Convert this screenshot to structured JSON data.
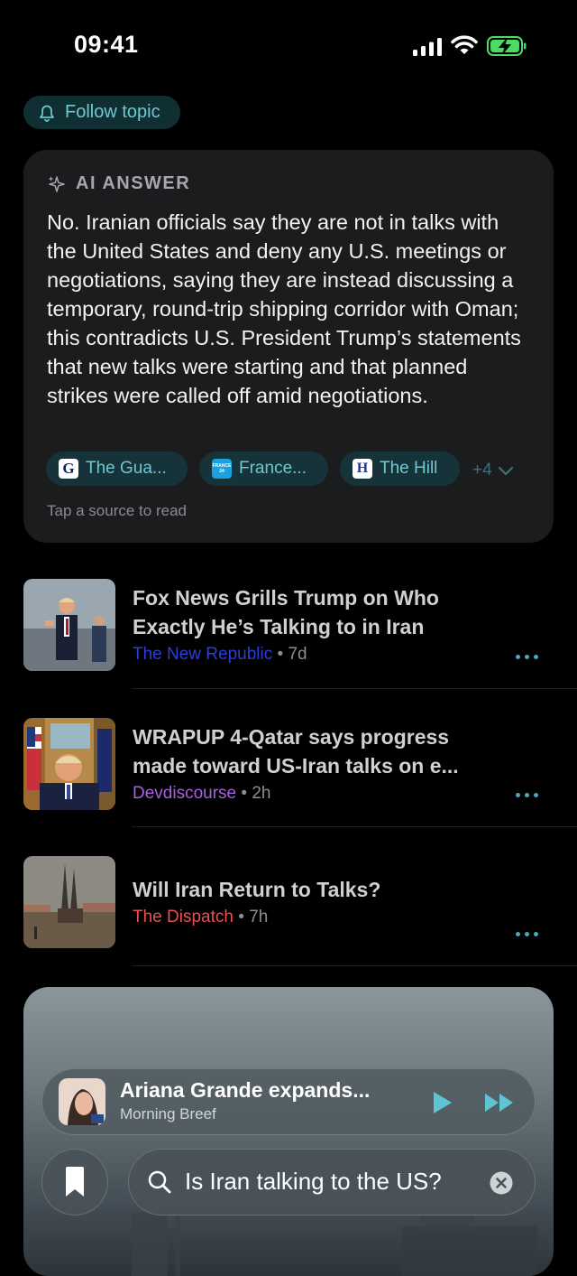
{
  "status_bar": {
    "time": "09:41"
  },
  "follow": {
    "label": "Follow topic"
  },
  "ai_answer": {
    "heading": "AI ANSWER",
    "text": "No. Iranian officials say they are not in talks with the United States and deny any U.S. meetings or negotiations, saying they are instead discussing a temporary, round-trip shipping corridor with Oman; this contradicts U.S. President Trump’s statements that new talks were starting and that planned strikes were called off amid negotiations.",
    "sources": [
      {
        "label": "The Gua...",
        "icon": "G"
      },
      {
        "label": "France...",
        "icon": "FRANCE 24"
      },
      {
        "label": "The Hill",
        "icon": "H"
      }
    ],
    "more": "+4",
    "hint": "Tap a source to read"
  },
  "articles": [
    {
      "title": "Fox News Grills Trump on Who Exactly He’s Talking to in Iran",
      "source": "The New Republic",
      "source_color": "#2a3fd8",
      "sep": "•",
      "ago": "7d"
    },
    {
      "title": "WRAPUP 4-Qatar says progress made toward US-Iran talks on e...",
      "source": "Devdiscourse",
      "source_color": "#a95fe0",
      "sep": "•",
      "ago": "2h"
    },
    {
      "title": "Will Iran Return to Talks?",
      "source": "The Dispatch",
      "source_color": "#e8514f",
      "sep": "•",
      "ago": "7h"
    }
  ],
  "player": {
    "title": "Ariana Grande expands...",
    "subtitle": "Morning Breef"
  },
  "search": {
    "query": "Is Iran talking to the US?"
  }
}
